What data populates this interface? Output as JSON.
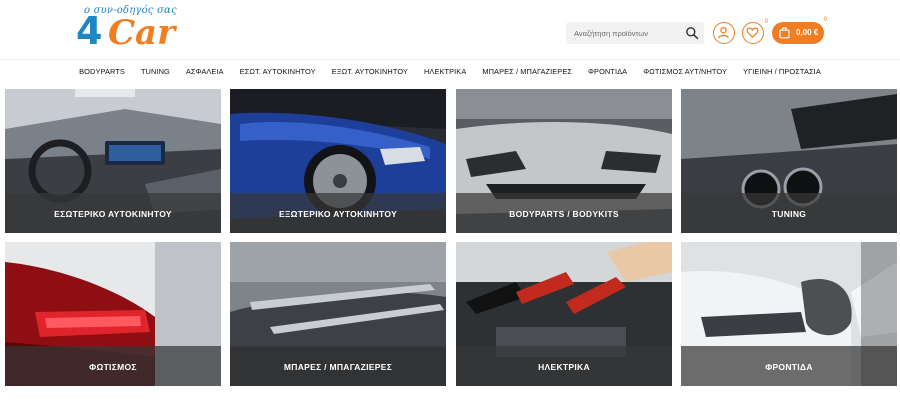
{
  "logo": {
    "tagline": "ο συν-οδηγός σας",
    "mark_number": "4",
    "mark_word": "Car"
  },
  "search": {
    "placeholder": "Αναζήτηση προϊόντων",
    "icon": "search-icon"
  },
  "header_icons": {
    "account_icon": "user-icon",
    "wishlist_icon": "heart-icon",
    "wishlist_count": "0",
    "cart_icon": "shopping-bag-icon",
    "cart_total": "0,00 €",
    "cart_count": "0"
  },
  "nav": {
    "items": [
      "BODYPARTS",
      "TUNING",
      "ΑΣΦΑΛΕΙΑ",
      "ΕΣΩΤ. ΑΥΤΟΚΙΝΗΤΟΥ",
      "ΕΞΩΤ. ΑΥΤΟΚΙΝΗΤΟΥ",
      "ΗΛΕΚΤΡΙΚΑ",
      "ΜΠΑΡΕΣ / ΜΠΑΓΑΖΙΕΡΕΣ",
      "ΦΡΟΝΤΙΔΑ",
      "ΦΩΤΙΣΜΟΣ ΑΥΤ/ΝΗΤΟΥ",
      "ΥΓΙΕΙΝΗ / ΠΡΟΣΤΑΣΙΑ"
    ]
  },
  "tiles": [
    {
      "label": "ΕΣΩΤΕΡΙΚΟ ΑΥΤΟΚΙΝΗΤΟΥ"
    },
    {
      "label": "ΕΞΩΤΕΡΙΚΟ ΑΥΤΟΚΙΝΗΤΟΥ"
    },
    {
      "label": "BODYPARTS / BODYKITS"
    },
    {
      "label": "TUNING"
    },
    {
      "label": "ΦΩΤΙΣΜΟΣ"
    },
    {
      "label": "ΜΠΑΡΕΣ / ΜΠΑΓΑΖΙΕΡΕΣ"
    },
    {
      "label": "ΗΛΕΚΤΡΙΚΑ"
    },
    {
      "label": "ΦΡΟΝΤΙΔΑ"
    }
  ],
  "colors": {
    "brand_orange": "#f07d21",
    "brand_blue": "#1f87c4",
    "label_band": "#373737"
  }
}
